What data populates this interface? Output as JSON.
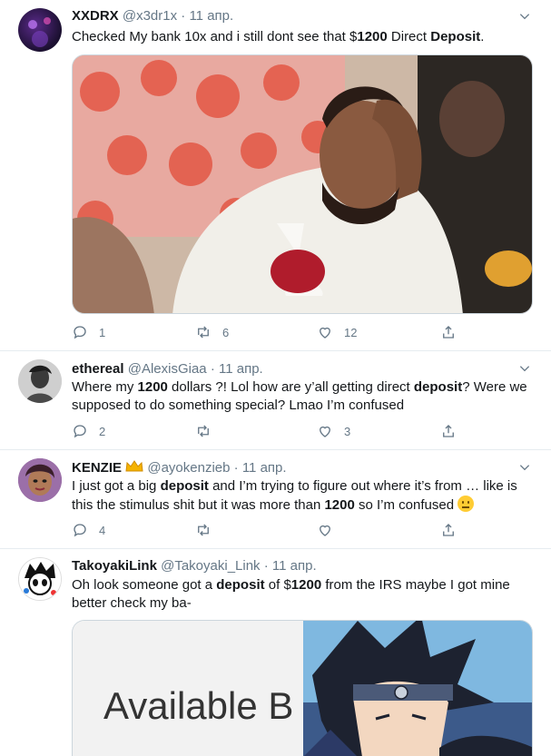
{
  "tweets": [
    {
      "name": "XXDRX",
      "handle": "@x3dr1x",
      "date": "11 апр.",
      "text_parts": [
        "Checked My bank 10x and i still dont see that $",
        "1200",
        " Direct ",
        "Deposit",
        "."
      ],
      "replies": "1",
      "retweets": "6",
      "likes": "12"
    },
    {
      "name": "ethereal",
      "handle": "@AlexisGiaa",
      "date": "11 апр.",
      "text_parts": [
        "Where my ",
        "1200",
        " dollars ?! Lol how are y’all getting direct ",
        "deposit",
        "? Were we supposed to do something special? Lmao I’m confused"
      ],
      "replies": "2",
      "retweets": "",
      "likes": "3"
    },
    {
      "name": "KENZIE",
      "handle": "@ayokenzieb",
      "date": "11 апр.",
      "text_parts": [
        "I just got a big ",
        "deposit",
        " and I’m trying to figure out where it’s from … like is this the stimulus shit but it was more than ",
        "1200",
        " so I’m confused "
      ],
      "replies": "4",
      "retweets": "",
      "likes": ""
    },
    {
      "name": "TakoyakiLink",
      "handle": "@Takoyaki_Link",
      "date": "11 апр.",
      "text_parts": [
        "Oh look someone got a ",
        "deposit",
        " of $",
        "1200",
        " from the IRS maybe I got mine better check my ba-"
      ],
      "media_text": "Available B",
      "replies": "",
      "retweets": "",
      "likes": ""
    }
  ],
  "separator": "·",
  "emoji": "😐",
  "colors": {
    "muted": "#657786",
    "border": "#e6ecf0",
    "text": "#14171a"
  }
}
